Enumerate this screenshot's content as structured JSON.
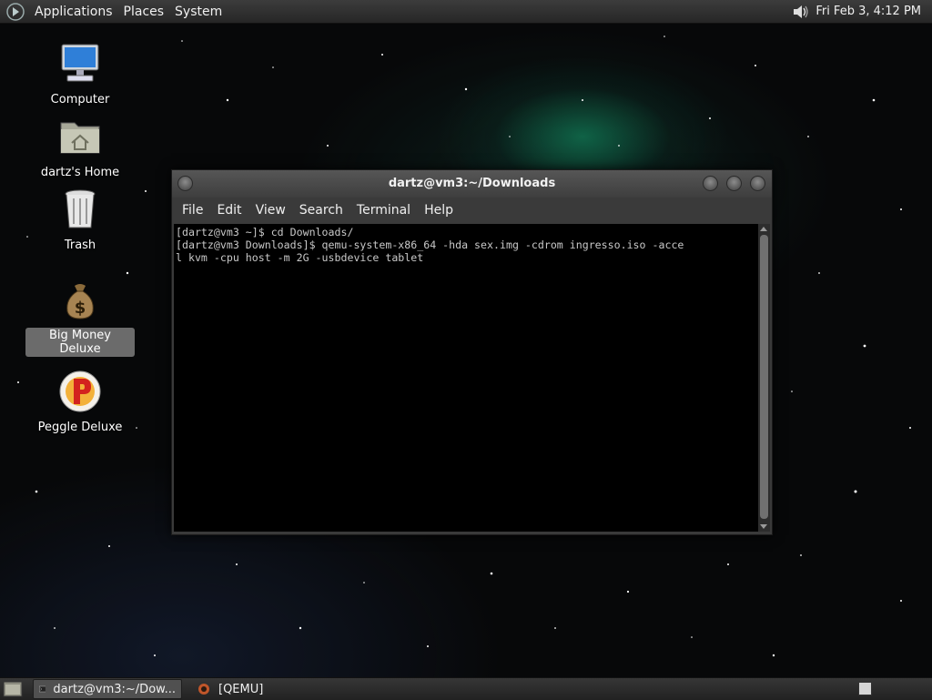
{
  "top_panel": {
    "menus": [
      "Applications",
      "Places",
      "System"
    ],
    "clock": "Fri Feb  3,  4:12 PM",
    "icons": {
      "logo": "gnome-foot-icon",
      "volume": "speaker-icon"
    }
  },
  "desktop": {
    "icons": [
      {
        "label": "Computer",
        "icon": "computer-monitor-icon"
      },
      {
        "label": "dartz's Home",
        "icon": "home-folder-icon"
      },
      {
        "label": "Trash",
        "icon": "trash-can-icon"
      },
      {
        "label": "Big Money Deluxe",
        "icon": "money-bag-icon",
        "selected": true
      },
      {
        "label": "Peggle Deluxe",
        "icon": "peggle-icon"
      }
    ]
  },
  "terminal": {
    "title": "dartz@vm3:~/Downloads",
    "menus": [
      "File",
      "Edit",
      "View",
      "Search",
      "Terminal",
      "Help"
    ],
    "lines": [
      "[dartz@vm3 ~]$ cd Downloads/",
      "[dartz@vm3 Downloads]$ qemu-system-x86_64 -hda sex.img -cdrom ingresso.iso -acce",
      "l kvm -cpu host -m 2G -usbdevice tablet"
    ],
    "colors": {
      "background": "#000000",
      "text": "#c8c8c8"
    }
  },
  "taskbar": {
    "tasks": [
      {
        "label": "dartz@vm3:~/Dow...",
        "icon": "terminal-icon",
        "active": true
      },
      {
        "label": "[QEMU]",
        "icon": "qemu-icon",
        "active": false
      }
    ]
  }
}
